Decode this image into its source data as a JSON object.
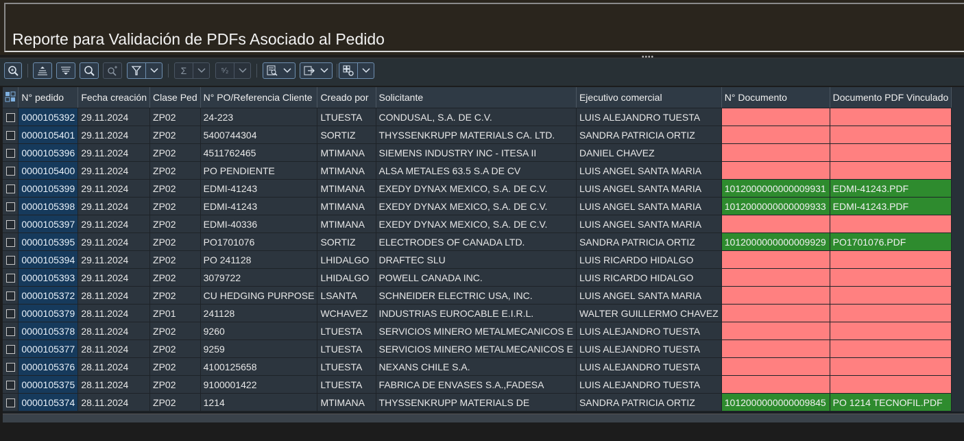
{
  "page": {
    "title": "Reporte para Validación de PDFs Asociado al Pedido"
  },
  "toolbar": {
    "buttons": [
      {
        "icon": "zoom-details-icon",
        "enabled": true
      },
      {
        "icon": "collapse-all-icon",
        "enabled": true
      },
      {
        "icon": "expand-all-icon",
        "enabled": true
      },
      {
        "icon": "search-icon",
        "enabled": true
      },
      {
        "icon": "search-next-icon",
        "enabled": false
      },
      {
        "icon": "filter-icon",
        "enabled": true
      },
      {
        "icon": "sum-icon",
        "enabled": false
      },
      {
        "icon": "subtotal-icon",
        "enabled": false
      },
      {
        "icon": "print-preview-icon",
        "enabled": true
      },
      {
        "icon": "export-icon",
        "enabled": true
      },
      {
        "icon": "layout-icon",
        "enabled": true
      }
    ]
  },
  "table": {
    "columns": [
      "N° pedido",
      "Fecha creación",
      "Clase Ped",
      "N° PO/Referencia Cliente",
      "Creado por",
      "Solicitante",
      "Ejecutivo comercial",
      "N° Documento",
      "Documento PDF Vinculado"
    ],
    "rows": [
      {
        "pedido": "0000105392",
        "fecha": "29.11.2024",
        "clase": "ZP02",
        "po": "24-223",
        "creado": "LTUESTA",
        "solicitante": "CONDUSAL, S.A. DE C.V.",
        "ejecutivo": "LUIS ALEJANDRO TUESTA",
        "documento": "",
        "pdf": "",
        "status": "missing"
      },
      {
        "pedido": "0000105401",
        "fecha": "29.11.2024",
        "clase": "ZP02",
        "po": "5400744304",
        "creado": "SORTIZ",
        "solicitante": "THYSSENKRUPP MATERIALS CA. LTD.",
        "ejecutivo": "SANDRA PATRICIA ORTIZ",
        "documento": "",
        "pdf": "",
        "status": "missing"
      },
      {
        "pedido": "0000105396",
        "fecha": "29.11.2024",
        "clase": "ZP02",
        "po": "4511762465",
        "creado": "MTIMANA",
        "solicitante": "SIEMENS INDUSTRY INC - ITESA II",
        "ejecutivo": "DANIEL CHAVEZ",
        "documento": "",
        "pdf": "",
        "status": "missing"
      },
      {
        "pedido": "0000105400",
        "fecha": "29.11.2024",
        "clase": "ZP02",
        "po": "PO PENDIENTE",
        "creado": "MTIMANA",
        "solicitante": "ALSA METALES 63.5 S.A DE CV",
        "ejecutivo": "LUIS ANGEL SANTA MARIA",
        "documento": "",
        "pdf": "",
        "status": "missing"
      },
      {
        "pedido": "0000105399",
        "fecha": "29.11.2024",
        "clase": "ZP02",
        "po": "EDMI-41243",
        "creado": "MTIMANA",
        "solicitante": "EXEDY DYNAX MEXICO, S.A. DE C.V.",
        "ejecutivo": "LUIS ANGEL SANTA MARIA",
        "documento": "1012000000000009931",
        "pdf": "EDMI-41243.PDF",
        "status": "linked"
      },
      {
        "pedido": "0000105398",
        "fecha": "29.11.2024",
        "clase": "ZP02",
        "po": "EDMI-41243",
        "creado": "MTIMANA",
        "solicitante": "EXEDY DYNAX MEXICO, S.A. DE C.V.",
        "ejecutivo": "LUIS ANGEL SANTA MARIA",
        "documento": "1012000000000009933",
        "pdf": "EDMI-41243.PDF",
        "status": "linked"
      },
      {
        "pedido": "0000105397",
        "fecha": "29.11.2024",
        "clase": "ZP02",
        "po": "EDMI-40336",
        "creado": "MTIMANA",
        "solicitante": "EXEDY DYNAX MEXICO, S.A. DE C.V.",
        "ejecutivo": "LUIS ANGEL SANTA MARIA",
        "documento": "",
        "pdf": "",
        "status": "missing"
      },
      {
        "pedido": "0000105395",
        "fecha": "29.11.2024",
        "clase": "ZP02",
        "po": "PO1701076",
        "creado": "SORTIZ",
        "solicitante": "ELECTRODES OF CANADA LTD.",
        "ejecutivo": "SANDRA PATRICIA ORTIZ",
        "documento": "1012000000000009929",
        "pdf": "PO1701076.PDF",
        "status": "linked"
      },
      {
        "pedido": "0000105394",
        "fecha": "29.11.2024",
        "clase": "ZP02",
        "po": "PO 241128",
        "creado": "LHIDALGO",
        "solicitante": "DRAFTEC SLU",
        "ejecutivo": "LUIS RICARDO HIDALGO",
        "documento": "",
        "pdf": "",
        "status": "missing"
      },
      {
        "pedido": "0000105393",
        "fecha": "29.11.2024",
        "clase": "ZP02",
        "po": "3079722",
        "creado": "LHIDALGO",
        "solicitante": "POWELL CANADA INC.",
        "ejecutivo": "LUIS RICARDO HIDALGO",
        "documento": "",
        "pdf": "",
        "status": "missing"
      },
      {
        "pedido": "0000105372",
        "fecha": "28.11.2024",
        "clase": "ZP02",
        "po": "CU HEDGING PURPOSE",
        "creado": "LSANTA",
        "solicitante": "SCHNEIDER ELECTRIC USA, INC.",
        "ejecutivo": "LUIS ANGEL SANTA MARIA",
        "documento": "",
        "pdf": "",
        "status": "missing"
      },
      {
        "pedido": "0000105379",
        "fecha": "28.11.2024",
        "clase": "ZP01",
        "po": "241128",
        "creado": "WCHAVEZ",
        "solicitante": "INDUSTRIAS EUROCABLE E.I.R.L.",
        "ejecutivo": "WALTER GUILLERMO CHAVEZ",
        "documento": "",
        "pdf": "",
        "status": "missing"
      },
      {
        "pedido": "0000105378",
        "fecha": "28.11.2024",
        "clase": "ZP02",
        "po": "9260",
        "creado": "LTUESTA",
        "solicitante": "SERVICIOS MINERO METALMECANICOS E",
        "ejecutivo": "LUIS ALEJANDRO TUESTA",
        "documento": "",
        "pdf": "",
        "status": "missing"
      },
      {
        "pedido": "0000105377",
        "fecha": "28.11.2024",
        "clase": "ZP02",
        "po": "9259",
        "creado": "LTUESTA",
        "solicitante": "SERVICIOS MINERO METALMECANICOS E",
        "ejecutivo": "LUIS ALEJANDRO TUESTA",
        "documento": "",
        "pdf": "",
        "status": "missing"
      },
      {
        "pedido": "0000105376",
        "fecha": "28.11.2024",
        "clase": "ZP02",
        "po": "4100125658",
        "creado": "LTUESTA",
        "solicitante": "NEXANS CHILE S.A.",
        "ejecutivo": "LUIS ALEJANDRO TUESTA",
        "documento": "",
        "pdf": "",
        "status": "missing"
      },
      {
        "pedido": "0000105375",
        "fecha": "28.11.2024",
        "clase": "ZP02",
        "po": "9100001422",
        "creado": "LTUESTA",
        "solicitante": "FABRICA DE ENVASES S.A.,FADESA",
        "ejecutivo": "LUIS ALEJANDRO TUESTA",
        "documento": "",
        "pdf": "",
        "status": "missing"
      },
      {
        "pedido": "0000105374",
        "fecha": "28.11.2024",
        "clase": "ZP02",
        "po": "1214",
        "creado": "MTIMANA",
        "solicitante": "THYSSENKRUPP MATERIALS DE",
        "ejecutivo": "SANDRA PATRICIA ORTIZ",
        "documento": "1012000000000009845",
        "pdf": "PO 1214 TECNOFIL.PDF",
        "status": "linked"
      }
    ]
  },
  "colors": {
    "missing": "#ff8080",
    "linked": "#2e8b2e",
    "key_column": "#163a5c"
  }
}
